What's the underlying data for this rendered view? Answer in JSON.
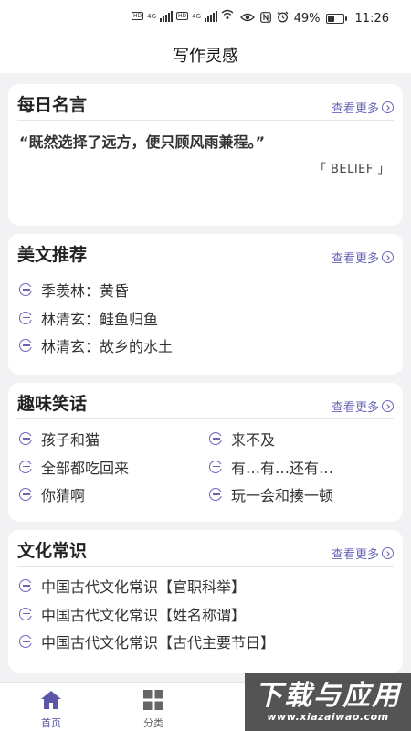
{
  "status": {
    "battery": "49%",
    "time": "11:26",
    "battery_level": 0.49,
    "hd_label": "HD",
    "net_label": "4G"
  },
  "header": {
    "title": "写作灵感"
  },
  "quote_card": {
    "title": "每日名言",
    "more": "查看更多",
    "quote": "“既然选择了远方，便只顾风雨兼程。”",
    "source": "「 BELIEF 」"
  },
  "article_card": {
    "title": "美文推荐",
    "more": "查看更多",
    "items": [
      "季羡林：黄昏",
      "林清玄：鲑鱼归鱼",
      "林清玄：故乡的水土"
    ]
  },
  "joke_card": {
    "title": "趣味笑话",
    "more": "查看更多",
    "items": [
      "孩子和猫",
      "来不及",
      "全部都吃回来",
      "有…有…还有…",
      "你猜啊",
      "玩一会和揍一顿"
    ]
  },
  "culture_card": {
    "title": "文化常识",
    "more": "查看更多",
    "items": [
      "中国古代文化常识【官职科举】",
      "中国古代文化常识【姓名称谓】",
      "中国古代文化常识【古代主要节日】"
    ]
  },
  "tabs": [
    {
      "label": "首页",
      "icon": "home-icon"
    },
    {
      "label": "分类",
      "icon": "grid-icon"
    }
  ],
  "watermark": {
    "main": "下载与应用",
    "sub": "www.xiazaiwao.com"
  },
  "colors": {
    "accent": "#6a64b8",
    "background": "#f2f2f4",
    "card": "#ffffff"
  }
}
